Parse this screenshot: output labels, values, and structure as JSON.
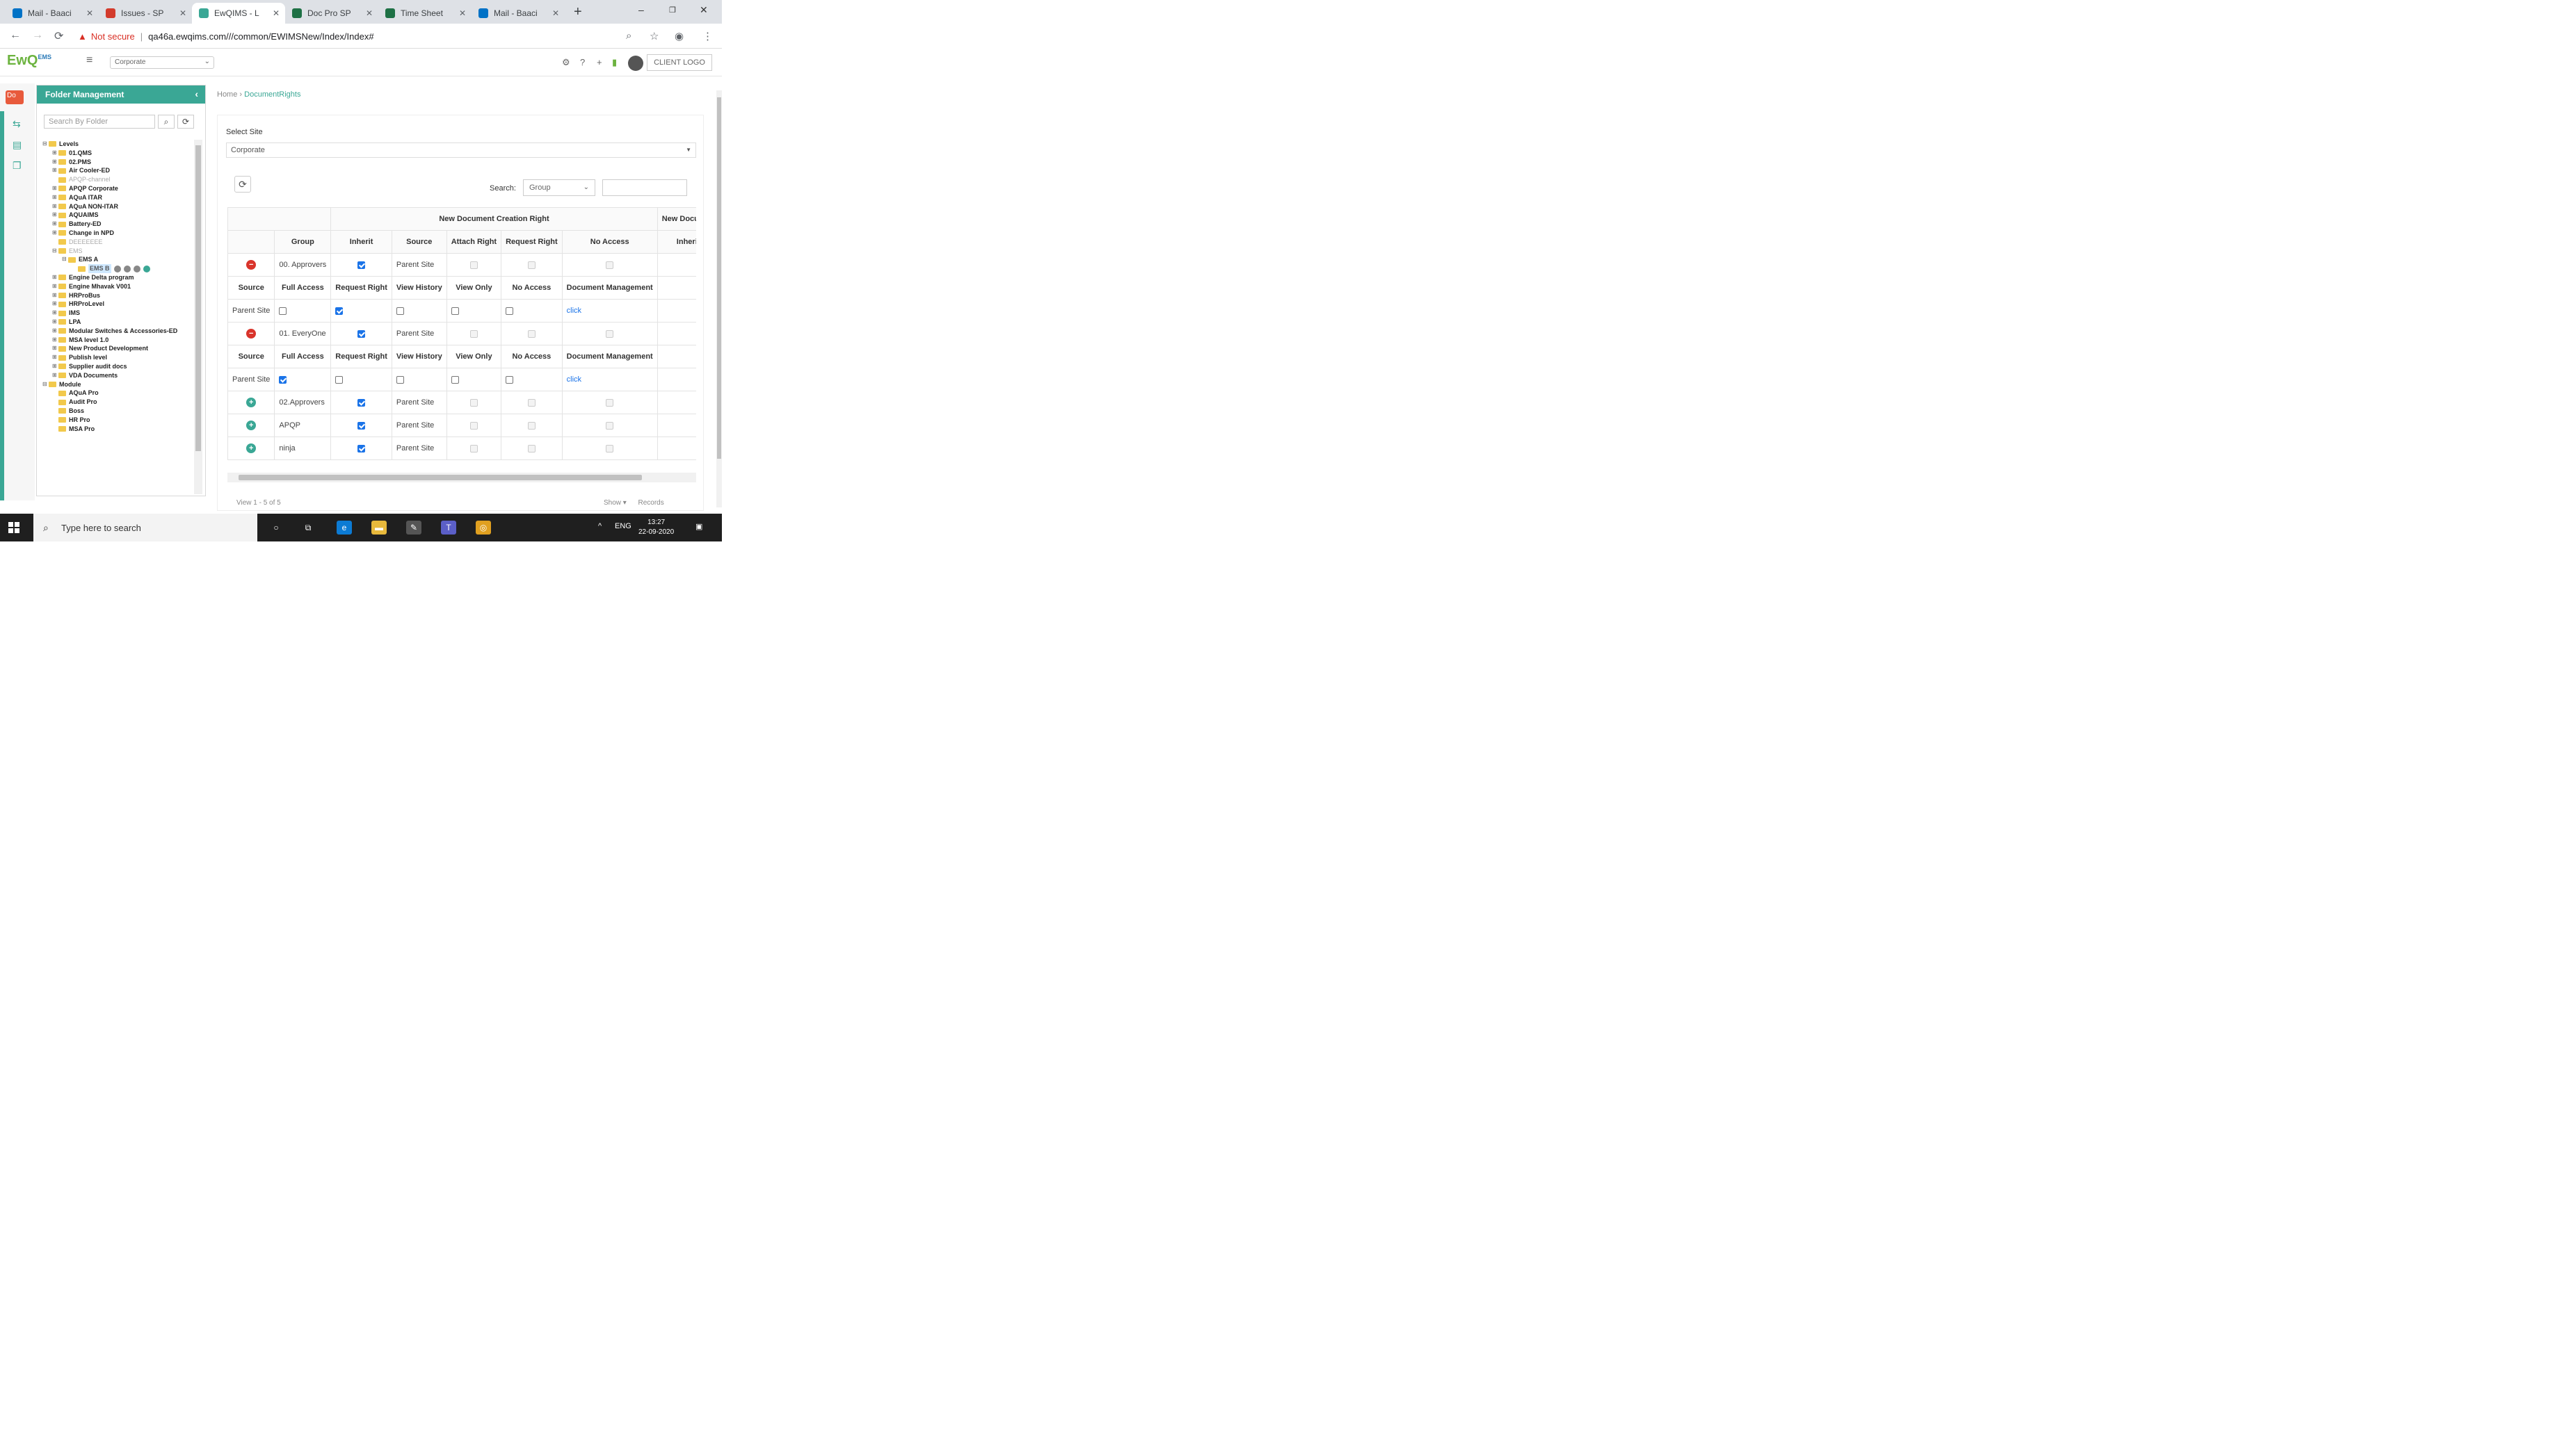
{
  "browser": {
    "tabs": [
      {
        "title": "Mail - Baaci",
        "color": "#0072c6",
        "active": false
      },
      {
        "title": "Issues - SP",
        "color": "#d33b2c",
        "active": false
      },
      {
        "title": "EwQIMS - L",
        "color": "#3aa795",
        "active": true
      },
      {
        "title": "Doc Pro SP",
        "color": "#1e7145",
        "active": false
      },
      {
        "title": "Time Sheet",
        "color": "#1e7145",
        "active": false
      },
      {
        "title": "Mail - Baaci",
        "color": "#0072c6",
        "active": false
      }
    ],
    "new_tab": "+",
    "window_controls": [
      "–",
      "❐",
      "✕"
    ],
    "security": "Not secure",
    "url": "qa46a.ewqims.com///common/EWIMSNew/Index/Index#"
  },
  "app": {
    "logo": "EwQ",
    "logo_sub": "EMS",
    "site_selector": "Corporate",
    "client_logo": "CLIENT LOGO"
  },
  "folder_panel": {
    "title": "Folder Management",
    "search_placeholder": "Search By Folder",
    "tree": [
      {
        "label": "Levels",
        "depth": 0,
        "toggle": "⊟"
      },
      {
        "label": "01.QMS",
        "depth": 1,
        "toggle": "⊞"
      },
      {
        "label": "02.PMS",
        "depth": 1,
        "toggle": "⊞"
      },
      {
        "label": "Air Cooler-ED",
        "depth": 1,
        "toggle": "⊞"
      },
      {
        "label": "APQP-channel",
        "depth": 1,
        "toggle": "",
        "dim": true
      },
      {
        "label": "APQP Corporate",
        "depth": 1,
        "toggle": "⊞"
      },
      {
        "label": "AQuA ITAR",
        "depth": 1,
        "toggle": "⊞"
      },
      {
        "label": "AQuA NON-ITAR",
        "depth": 1,
        "toggle": "⊞"
      },
      {
        "label": "AQUAIMS",
        "depth": 1,
        "toggle": "⊞"
      },
      {
        "label": "Battery-ED",
        "depth": 1,
        "toggle": "⊞"
      },
      {
        "label": "Change in NPD",
        "depth": 1,
        "toggle": "⊞"
      },
      {
        "label": "DEEEEEEE",
        "depth": 1,
        "toggle": "",
        "dim": true
      },
      {
        "label": "EMS",
        "depth": 1,
        "toggle": "⊟",
        "dim": true
      },
      {
        "label": "EMS A",
        "depth": 2,
        "toggle": "⊟"
      },
      {
        "label": "EMS B",
        "depth": 3,
        "toggle": "",
        "selected": true
      },
      {
        "label": "Engine Delta program",
        "depth": 1,
        "toggle": "⊞"
      },
      {
        "label": "Engine Mhavak V001",
        "depth": 1,
        "toggle": "⊞"
      },
      {
        "label": "HRProBus",
        "depth": 1,
        "toggle": "⊞"
      },
      {
        "label": "HRProLevel",
        "depth": 1,
        "toggle": "⊞"
      },
      {
        "label": "IMS",
        "depth": 1,
        "toggle": "⊞"
      },
      {
        "label": "LPA",
        "depth": 1,
        "toggle": "⊞"
      },
      {
        "label": "Modular Switches & Accessories-ED",
        "depth": 1,
        "toggle": "⊞"
      },
      {
        "label": "MSA level 1.0",
        "depth": 1,
        "toggle": "⊞"
      },
      {
        "label": "New Product Development",
        "depth": 1,
        "toggle": "⊞"
      },
      {
        "label": "Publish level",
        "depth": 1,
        "toggle": "⊞"
      },
      {
        "label": "Supplier audit docs",
        "depth": 1,
        "toggle": "⊞"
      },
      {
        "label": "VDA Documents",
        "depth": 1,
        "toggle": "⊞"
      },
      {
        "label": "Module",
        "depth": 0,
        "toggle": "⊟"
      },
      {
        "label": "AQuA Pro",
        "depth": 1,
        "toggle": ""
      },
      {
        "label": "Audit Pro",
        "depth": 1,
        "toggle": ""
      },
      {
        "label": "Boss",
        "depth": 1,
        "toggle": ""
      },
      {
        "label": "HR Pro",
        "depth": 1,
        "toggle": ""
      },
      {
        "label": "MSA Pro",
        "depth": 1,
        "toggle": ""
      }
    ]
  },
  "breadcrumb": {
    "home": "Home",
    "current": "DocumentRights"
  },
  "main": {
    "select_site_label": "Select Site",
    "select_site_value": "Corporate",
    "search_label": "Search:",
    "search_field": "Group",
    "group_header_1": "New Document Creation Right",
    "group_header_2": "New Documen",
    "columns": [
      "Group",
      "Inherit",
      "Source",
      "Attach Right",
      "Request Right",
      "No Access",
      "Inherit"
    ],
    "sub_columns": [
      "Source",
      "Full Access",
      "Request Right",
      "View History",
      "View Only",
      "No Access",
      "Document Management"
    ],
    "rows": [
      {
        "group": "00. Approvers",
        "expanded": true,
        "inherit": true,
        "source": "Parent Site",
        "inherit2": false,
        "sub": {
          "source": "Parent Site",
          "full": false,
          "request": true,
          "history": false,
          "view": false,
          "noaccess": false,
          "docmgmt": "click"
        }
      },
      {
        "group": "01. EveryOne",
        "expanded": true,
        "inherit": true,
        "source": "Parent Site",
        "inherit2": true,
        "sub": {
          "source": "Parent Site",
          "full": true,
          "request": false,
          "history": false,
          "view": false,
          "noaccess": false,
          "docmgmt": "click"
        }
      },
      {
        "group": "02.Approvers",
        "expanded": false,
        "inherit": true,
        "source": "Parent Site",
        "inherit2": true
      },
      {
        "group": "APQP",
        "expanded": false,
        "inherit": true,
        "source": "Parent Site",
        "inherit2": true
      },
      {
        "group": "ninja",
        "expanded": false,
        "inherit": true,
        "source": "Parent Site",
        "inherit2": true
      }
    ],
    "pager_left": "View 1 - 5 of 5",
    "pager_show": "Show",
    "pager_records": "Records"
  },
  "taskbar": {
    "search_placeholder": "Type here to search",
    "lang": "ENG",
    "time": "13:27",
    "date": "22-09-2020"
  }
}
